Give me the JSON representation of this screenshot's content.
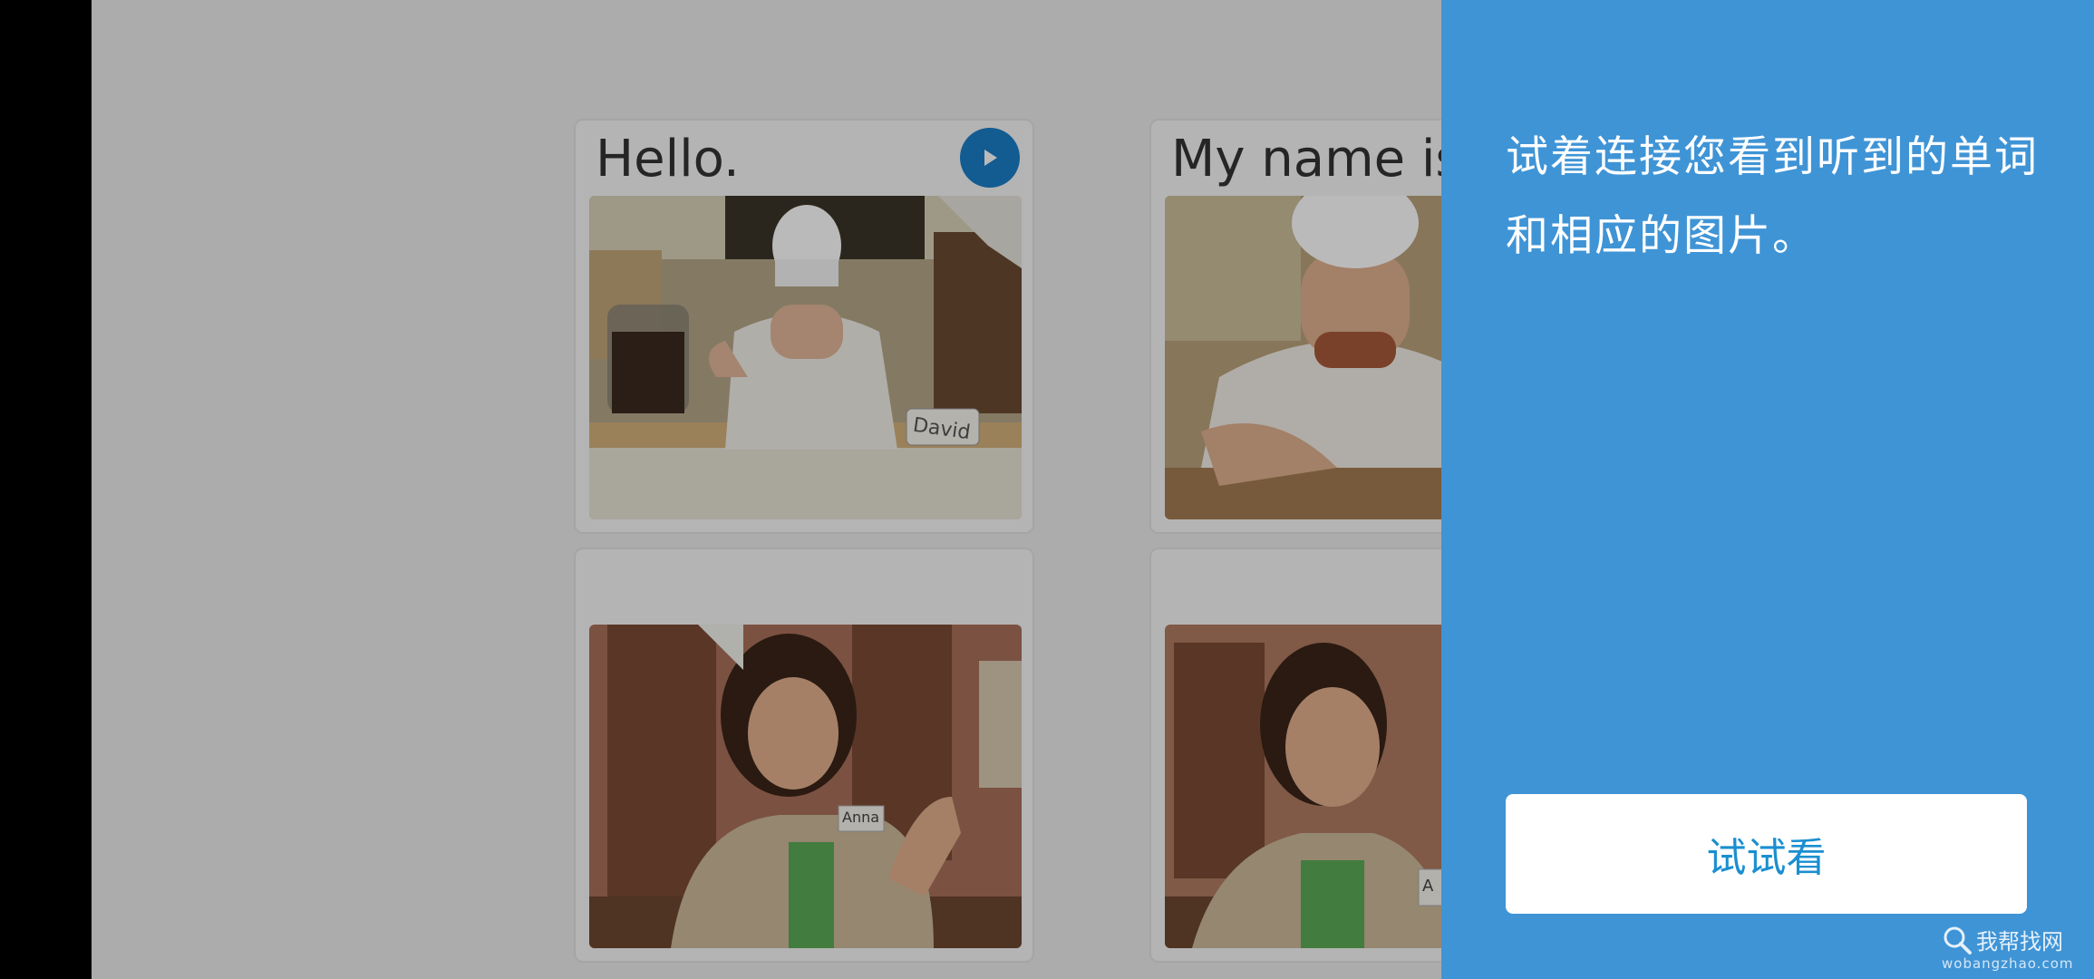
{
  "cards": [
    {
      "title": "Hello.",
      "name_tag": "David",
      "has_play": true
    },
    {
      "title": "My name is David.",
      "name_tag": "",
      "has_play": false
    },
    {
      "title": "",
      "name_tag": "Anna",
      "has_play": false
    },
    {
      "title": "",
      "name_tag": "A",
      "has_play": false
    }
  ],
  "panel": {
    "instruction": "试着连接您看到听到的单词和相应的图片。",
    "button_label": "试试看"
  },
  "watermark": {
    "name": "我帮找网",
    "url": "wobangzhao.com"
  },
  "colors": {
    "panel_bg": "#3f94d6",
    "button_text": "#1a8fd0",
    "play_button": "#1a7fc9"
  },
  "icons": {
    "play": "play-icon",
    "search": "search-icon"
  }
}
